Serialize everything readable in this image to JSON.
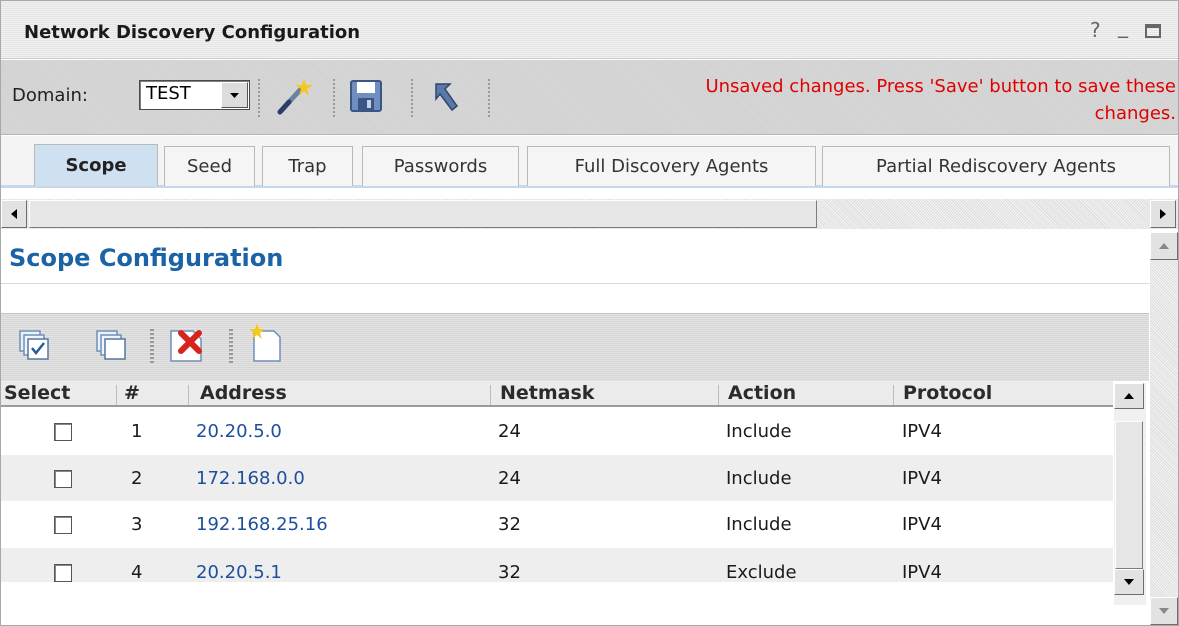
{
  "window": {
    "title": "Network Discovery Configuration",
    "help_label": "?",
    "minimize_label": "_",
    "maximize_label": "□"
  },
  "toolbar": {
    "domain_label": "Domain:",
    "domain_value": "TEST",
    "unsaved_message_line1": "Unsaved changes. Press 'Save' button to save these",
    "unsaved_message_line2": "changes.",
    "icons": [
      "magic-wand-icon",
      "save-icon",
      "undo-icon"
    ]
  },
  "tabs": [
    {
      "label": "Scope",
      "active": true
    },
    {
      "label": "Seed",
      "active": false
    },
    {
      "label": "Trap",
      "active": false
    },
    {
      "label": "Passwords",
      "active": false
    },
    {
      "label": "Full Discovery Agents",
      "active": false
    },
    {
      "label": "Partial Rediscovery Agents",
      "active": false
    }
  ],
  "section": {
    "title": "Scope Configuration"
  },
  "grid_toolbar": {
    "icons": [
      "select-all-icon",
      "copy-icon",
      "delete-icon",
      "new-icon"
    ]
  },
  "table": {
    "columns": [
      "Select",
      "#",
      "Address",
      "Netmask",
      "Action",
      "Protocol"
    ],
    "rows": [
      {
        "num": "1",
        "address": "20.20.5.0",
        "netmask": "24",
        "action": "Include",
        "protocol": "IPV4",
        "checked": false
      },
      {
        "num": "2",
        "address": "172.168.0.0",
        "netmask": "24",
        "action": "Include",
        "protocol": "IPV4",
        "checked": false
      },
      {
        "num": "3",
        "address": "192.168.25.16",
        "netmask": "32",
        "action": "Include",
        "protocol": "IPV4",
        "checked": false
      },
      {
        "num": "4",
        "address": "20.20.5.1",
        "netmask": "32",
        "action": "Exclude",
        "protocol": "IPV4",
        "checked": false
      }
    ]
  },
  "colors": {
    "accent_blue": "#1a63a6",
    "link_blue": "#1d4f9c",
    "warning_red": "#e00000",
    "active_tab": "#cfe0f0"
  }
}
